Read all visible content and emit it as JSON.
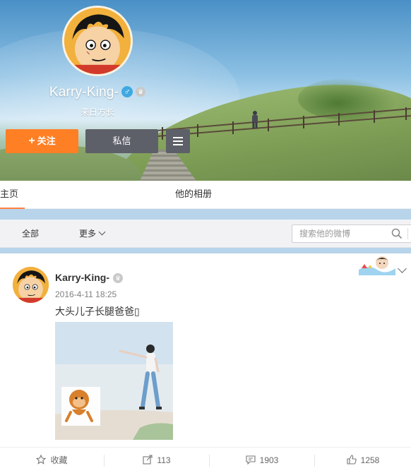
{
  "profile": {
    "username": "Karry-King-",
    "gender_icon": "male-icon",
    "vip_icon": "crown-icon",
    "location": "来日方长",
    "follow_label": "关注",
    "message_label": "私信",
    "menu_icon": "menu-icon"
  },
  "tabs": [
    {
      "label": "主页",
      "active": true
    },
    {
      "label": "他的相册",
      "active": false
    }
  ],
  "filter": {
    "all_label": "全部",
    "more_label": "更多",
    "search_placeholder": "搜索他的微博",
    "search_icon": "search-icon"
  },
  "post": {
    "author": "Karry-King-",
    "time": "2016-4-11 18:25",
    "text": "大头儿子长腿爸爸▯",
    "image_subject": "photo-thumbnail"
  },
  "actions": [
    {
      "icon": "star-icon",
      "label": "收藏"
    },
    {
      "icon": "share-icon",
      "label": "113"
    },
    {
      "icon": "comment-icon",
      "label": "1903"
    },
    {
      "icon": "like-icon",
      "label": "1258"
    }
  ],
  "colors": {
    "follow_button": "#ff7f25",
    "dark_button": "#5d6068",
    "active_tab_underline": "#ff8140",
    "divider_band": "#b7d4ea",
    "gender_badge": "#3fa8e0"
  }
}
